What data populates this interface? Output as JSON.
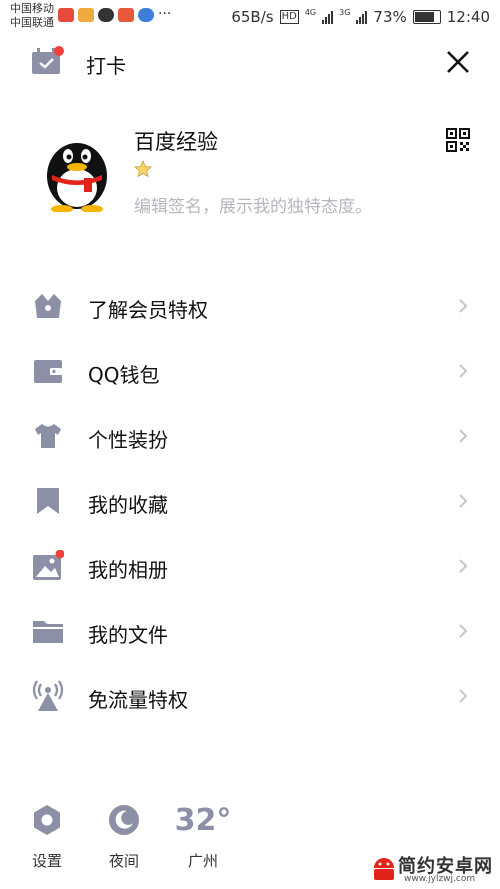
{
  "status_bar": {
    "carrier_1": "中国移动",
    "carrier_2": "中国联通",
    "more": "···",
    "speed": "65B/s",
    "hd": "HD",
    "net_1": "4G",
    "net_2": "3G",
    "battery": "73%",
    "battery_level": 0.73,
    "time": "12:40"
  },
  "header": {
    "checkin_label": "打卡",
    "close_icon": "close-icon"
  },
  "profile": {
    "nickname": "百度经验",
    "signature": "编辑签名，展示我的独特态度。",
    "qr_icon": "qr-code-icon"
  },
  "menu": {
    "items": [
      {
        "label": "了解会员特权",
        "icon": "crown-basket-icon"
      },
      {
        "label": "QQ钱包",
        "icon": "wallet-icon"
      },
      {
        "label": "个性装扮",
        "icon": "tshirt-icon"
      },
      {
        "label": "我的收藏",
        "icon": "bookmark-icon"
      },
      {
        "label": "我的相册",
        "icon": "photo-icon"
      },
      {
        "label": "我的文件",
        "icon": "folder-icon"
      },
      {
        "label": "免流量特权",
        "icon": "antenna-icon"
      }
    ]
  },
  "bottom": {
    "settings_label": "设置",
    "night_label": "夜间",
    "temperature": "32°",
    "city": "广州"
  },
  "watermark": {
    "text": "简约安卓网",
    "url": "www.jylzwj.com"
  },
  "colors": {
    "icon_gray": "#8c90a6",
    "badge_red": "#f0413c",
    "chevron": "#c4c6cc"
  }
}
